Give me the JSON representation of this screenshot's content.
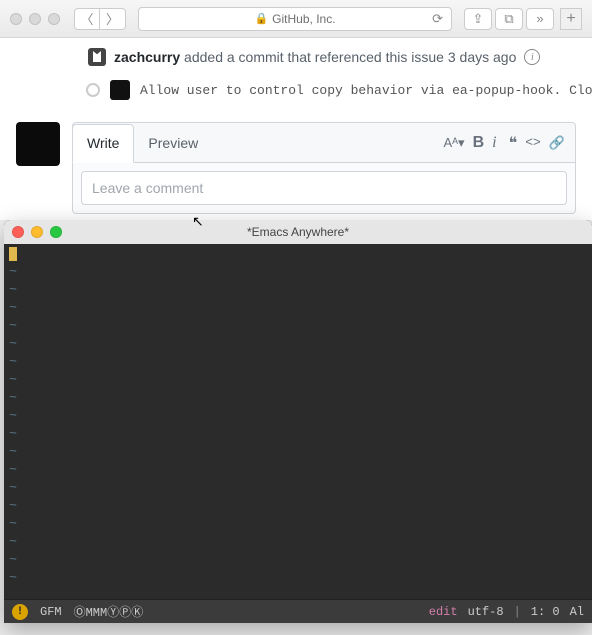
{
  "safari": {
    "traffic_inactive": "#d9d9d9",
    "address": {
      "lock_glyph": "🔒",
      "host": "GitHub, Inc.",
      "reload_glyph": "⟳"
    },
    "nav": {
      "back_glyph": "〈",
      "forward_glyph": "〉"
    },
    "right_tools": {
      "share_glyph": "⇪",
      "tabs_glyph": "⧉",
      "more_glyph": "»",
      "plus_glyph": "+"
    }
  },
  "github": {
    "ref": {
      "user": "zachcurry",
      "action": " added a commit that referenced this issue ",
      "time": "3 days ago",
      "info_glyph": "i"
    },
    "commit": {
      "message_pre": "  Allow user to control copy behavior via ",
      "message_code": "ea-popup-hook",
      "message_post": ". ",
      "closes": "Clos"
    },
    "compose": {
      "tabs": {
        "write": "Write",
        "preview": "Preview"
      },
      "toolbar": {
        "heading_glyph": "Aᴬ▾",
        "bold_glyph": "B",
        "italic_glyph": "i",
        "quote_glyph": "❝",
        "code_glyph": "<>",
        "link_glyph": "🔗"
      },
      "placeholder": "Leave a comment"
    }
  },
  "emacs": {
    "title": "*Emacs Anywhere*",
    "traffic": {
      "close": "#ff5f57",
      "min": "#febc2e",
      "max": "#28c840"
    },
    "tilde": "~",
    "tilde_count": 18,
    "modeline": {
      "warn_glyph": "!",
      "mode": "GFM",
      "minor": "ⓄMMMⓎⓅⓀ",
      "edit": "edit",
      "encoding": "utf-8",
      "position": "1: 0",
      "tail": "Al"
    }
  },
  "cursor_glyph": "↖"
}
